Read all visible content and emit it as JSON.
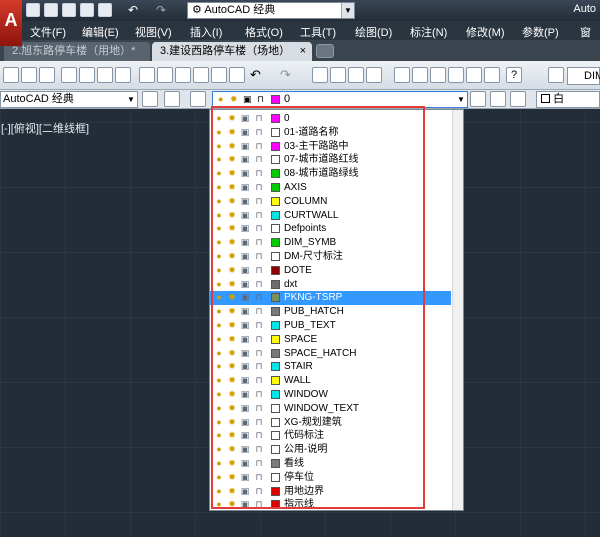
{
  "app": {
    "window_title": "Auto",
    "workspace_selector": "AutoCAD 经典",
    "logo_letter": "A"
  },
  "menu": [
    "文件(F)",
    "编辑(E)",
    "视图(V)",
    "插入(I)",
    "格式(O)",
    "工具(T)",
    "绘图(D)",
    "标注(N)",
    "修改(M)",
    "参数(P)",
    "窗口"
  ],
  "tabs": [
    {
      "label": "2.旭东路停车楼（用地）*"
    },
    {
      "label": "3.建设西路停车楼（场地）"
    }
  ],
  "tab_close": "×",
  "toolbar": {
    "workspace": "AutoCAD 经典",
    "dim_style": "DIM",
    "color_label": "白",
    "current_layer": "0",
    "help_label": "?"
  },
  "viewport_label": "[-][俯视][二维线框]",
  "layers": [
    {
      "name": "0",
      "color": "#ff00ff"
    },
    {
      "name": "01-道路名称",
      "color": "#ffffff"
    },
    {
      "name": "03-主干路路中",
      "color": "#ff00ff"
    },
    {
      "name": "07-城市道路红线",
      "color": "#ffffff"
    },
    {
      "name": "08-城市道路绿线",
      "color": "#00cc00"
    },
    {
      "name": "AXIS",
      "color": "#00cc00"
    },
    {
      "name": "COLUMN",
      "color": "#ffff00"
    },
    {
      "name": "CURTWALL",
      "color": "#00e5e5"
    },
    {
      "name": "Defpoints",
      "color": "#ffffff"
    },
    {
      "name": "DIM_SYMB",
      "color": "#00cc00"
    },
    {
      "name": "DM-尺寸标注",
      "color": "#ffffff"
    },
    {
      "name": "DOTE",
      "color": "#8b0000"
    },
    {
      "name": "dxt",
      "color": "#6e6e6e"
    },
    {
      "name": "PKNG-TSRP",
      "color": "#7a8f5a"
    },
    {
      "name": "PUB_HATCH",
      "color": "#7a7a7a"
    },
    {
      "name": "PUB_TEXT",
      "color": "#00e5e5"
    },
    {
      "name": "SPACE",
      "color": "#ffff00"
    },
    {
      "name": "SPACE_HATCH",
      "color": "#7a7a7a"
    },
    {
      "name": "STAIR",
      "color": "#00e5e5"
    },
    {
      "name": "WALL",
      "color": "#ffff00"
    },
    {
      "name": "WINDOW",
      "color": "#00e5e5"
    },
    {
      "name": "WINDOW_TEXT",
      "color": "#ffffff"
    },
    {
      "name": "XG-规划建筑",
      "color": "#ffffff"
    },
    {
      "name": "代码标注",
      "color": "#ffffff"
    },
    {
      "name": "公用-说明",
      "color": "#ffffff"
    },
    {
      "name": "看线",
      "color": "#7a7a7a"
    },
    {
      "name": "停车位",
      "color": "#ffffff"
    },
    {
      "name": "用地边界",
      "color": "#dd0000"
    },
    {
      "name": "指示线",
      "color": "#dd0000"
    }
  ],
  "selected_layer": "PKNG-TSRP",
  "highlight_color": "#e23b3b",
  "layer_icons": [
    "light-bulb-icon",
    "sun-icon",
    "viewport-freeze-icon",
    "lock-icon"
  ]
}
